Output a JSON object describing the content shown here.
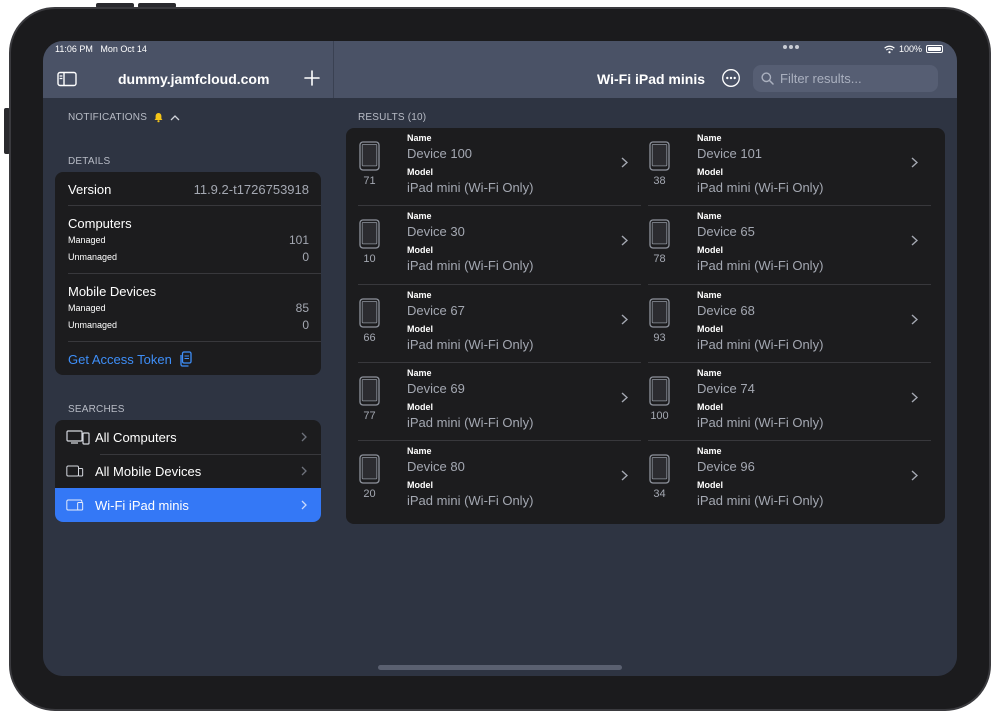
{
  "status_bar": {
    "time": "11:06 PM",
    "date": "Mon Oct 14",
    "battery": "100%"
  },
  "sidebar": {
    "server": "dummy.jamfcloud.com",
    "notifications_label": "NOTIFICATIONS",
    "details_label": "DETAILS",
    "details": {
      "version_label": "Version",
      "version_value": "11.9.2-t1726753918",
      "computers": {
        "title": "Computers",
        "managed_label": "Managed",
        "managed": "101",
        "unmanaged_label": "Unmanaged",
        "unmanaged": "0"
      },
      "mobile": {
        "title": "Mobile Devices",
        "managed_label": "Managed",
        "managed": "85",
        "unmanaged_label": "Unmanaged",
        "unmanaged": "0"
      },
      "token_link": "Get Access Token"
    },
    "searches_label": "SEARCHES",
    "searches": [
      {
        "label": "All Computers",
        "icon": "computers-icon",
        "selected": false
      },
      {
        "label": "All Mobile Devices",
        "icon": "mobile-devices-icon",
        "selected": false
      },
      {
        "label": "Wi-Fi iPad minis",
        "icon": "ipad-icon",
        "selected": true
      }
    ]
  },
  "results": {
    "title": "Wi-Fi iPad minis",
    "search_placeholder": "Filter results...",
    "label": "RESULTS (10)",
    "name_key": "Name",
    "model_key": "Model",
    "items": [
      {
        "id": "71",
        "name": "Device 100",
        "model": "iPad mini (Wi-Fi Only)"
      },
      {
        "id": "38",
        "name": "Device 101",
        "model": "iPad mini (Wi-Fi Only)"
      },
      {
        "id": "10",
        "name": "Device 30",
        "model": "iPad mini (Wi-Fi Only)"
      },
      {
        "id": "78",
        "name": "Device 65",
        "model": "iPad mini (Wi-Fi Only)"
      },
      {
        "id": "66",
        "name": "Device 67",
        "model": "iPad mini (Wi-Fi Only)"
      },
      {
        "id": "93",
        "name": "Device 68",
        "model": "iPad mini (Wi-Fi Only)"
      },
      {
        "id": "77",
        "name": "Device 69",
        "model": "iPad mini (Wi-Fi Only)"
      },
      {
        "id": "100",
        "name": "Device 74",
        "model": "iPad mini (Wi-Fi Only)"
      },
      {
        "id": "20",
        "name": "Device 80",
        "model": "iPad mini (Wi-Fi Only)"
      },
      {
        "id": "34",
        "name": "Device 96",
        "model": "iPad mini (Wi-Fi Only)"
      }
    ]
  },
  "colors": {
    "accent": "#3478f6",
    "link": "#3e8ef7",
    "header": "#4a5266",
    "background": "#2e3442",
    "card": "#1c1c1e"
  }
}
